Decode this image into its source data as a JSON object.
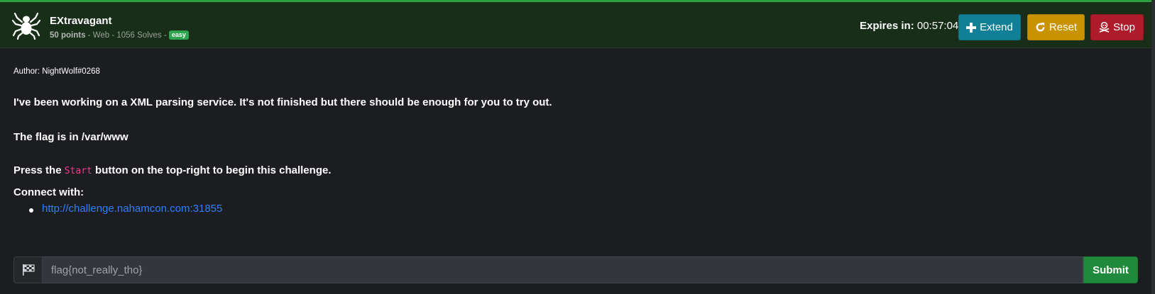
{
  "challenge": {
    "title": "EXtravagant",
    "points": "50 points",
    "meta_rest": " - Web - 1056 Solves - ",
    "difficulty": "easy",
    "icon": "spider-icon"
  },
  "timer": {
    "label": "Expires in:",
    "value": " 00:57:04"
  },
  "actions": {
    "extend_label": "Extend",
    "reset_label": "Reset",
    "stop_label": "Stop"
  },
  "description": {
    "author": "Author: NightWolf#0268",
    "line1": "I've been working on a XML parsing service. It's not finished but there should be enough for you to try out.",
    "line2": "The flag is in /var/www",
    "line3_prefix": "Press the ",
    "line3_code": "Start",
    "line3_suffix": " button on the top-right to begin this challenge.",
    "connect_label": "Connect with:",
    "connect_url": "http://challenge.nahamcon.com:31855"
  },
  "flag_form": {
    "placeholder": "flag{not_really_tho}",
    "submit_label": "Submit"
  },
  "colors": {
    "header_bg": "#182e18",
    "extend": "#117f95",
    "reset": "#c99300",
    "stop": "#ae1c2c",
    "submit": "#1f8a3c",
    "link": "#2f7fff",
    "code": "#e83e8c"
  }
}
